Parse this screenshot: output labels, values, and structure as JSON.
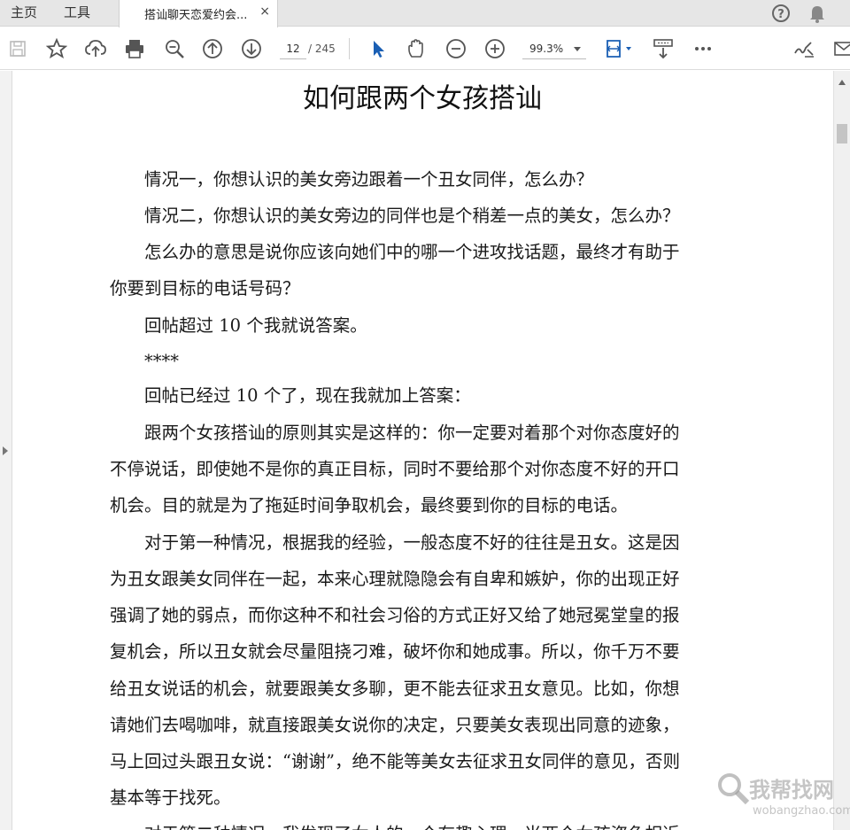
{
  "tabs": {
    "home": "主页",
    "tools": "工具",
    "document": "搭讪聊天恋爱约会...",
    "close": "×"
  },
  "toolbar": {
    "current_page": "12",
    "total_pages": "/ 245",
    "zoom": "99.3%"
  },
  "icons": {
    "save": "save-icon",
    "bookmark": "star-icon",
    "upload": "cloud-upload-icon",
    "print": "printer-icon",
    "zoom": "zoom-out-magnifier-icon",
    "prev": "arrow-up-circle-icon",
    "next": "arrow-down-circle-icon",
    "select": "pointer-icon",
    "hand": "hand-icon",
    "zoom_out": "minus-circle-icon",
    "zoom_in": "plus-circle-icon",
    "fit": "fit-page-icon",
    "scroll_mode": "scroll-mode-icon",
    "more": "more-icon",
    "sign": "sign-icon",
    "email": "email-icon",
    "help": "help-icon",
    "notify": "bell-icon"
  },
  "document": {
    "title": "如何跟两个女孩搭讪",
    "lines": [
      "　　情况一，你想认识的美女旁边跟着一个丑女同伴，怎么办？",
      "　　情况二，你想认识的美女旁边的同伴也是个稍差一点的美女，怎么办？",
      "　　怎么办的意思是说你应该向她们中的哪一个进攻找话题，最终才有助于",
      "你要到目标的电话号码？",
      "　　回帖超过 10 个我就说答案。",
      "　　****",
      "　　回帖已经过 10 个了，现在我就加上答案：",
      "　　跟两个女孩搭讪的原则其实是这样的：你一定要对着那个对你态度好的",
      "不停说话，即使她不是你的真正目标，同时不要给那个对你态度不好的开口",
      "机会。目的就是为了拖延时间争取机会，最终要到你的目标的电话。",
      "　　对于第一种情况，根据我的经验，一般态度不好的往往是丑女。这是因",
      "为丑女跟美女同伴在一起，本来心理就隐隐会有自卑和嫉妒，你的出现正好",
      "强调了她的弱点，而你这种不和社会习俗的方式正好又给了她冠冕堂皇的报",
      "复机会，所以丑女就会尽量阻挠刁难，破坏你和她成事。所以，你千万不要",
      "给丑女说话的机会，就要跟美女多聊，更不能去征求丑女意见。比如，你想",
      "请她们去喝咖啡，就直接跟美女说你的决定，只要美女表现出同意的迹象，",
      "马上回过头跟丑女说：“谢谢”，绝不能等美女去征求丑女同伴的意见，否则",
      "基本等于找死。",
      "　　对于第二种情况，我发现了女人的一个有趣心理，当两个女孩姿色相近"
    ]
  },
  "watermark": {
    "text": "我帮找网",
    "url": "wobangzhao.com"
  },
  "colors": {
    "accent": "#1a5fb4",
    "icon": "#555555",
    "tabbar": "#e6e6e6"
  }
}
